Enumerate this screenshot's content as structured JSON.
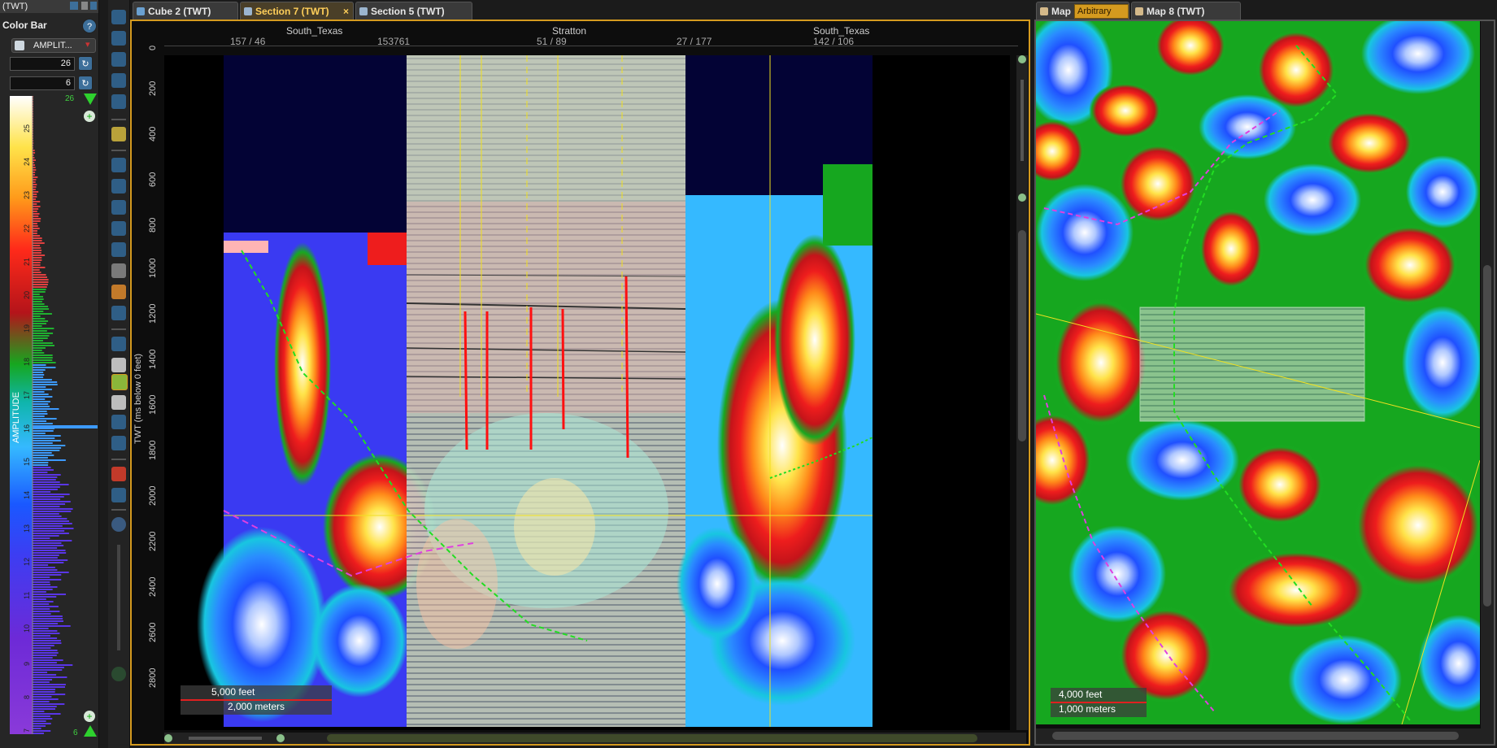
{
  "colorbar_panel": {
    "window_label": "(TWT)",
    "title": "Color Bar",
    "attribute_select": "AMPLIT...",
    "max_value": "26",
    "min_value": "6",
    "axis_label": "AMPLITUDE",
    "top_marker": "26",
    "bottom_marker": "6",
    "scale_ticks": [
      "25",
      "24",
      "23",
      "22",
      "21",
      "20",
      "19",
      "18",
      "17",
      "16",
      "15",
      "14",
      "13",
      "12",
      "11",
      "10",
      "9",
      "8",
      "7"
    ]
  },
  "tabs": {
    "left": [
      {
        "label": "Cube 2 (TWT)"
      },
      {
        "label": "Section 7 (TWT)",
        "close": "×"
      },
      {
        "label": "Section 5 (TWT)"
      }
    ],
    "right": [
      {
        "label": "Map"
      },
      {
        "label": "Arbitrary Line"
      },
      {
        "label": "Map 8 (TWT)"
      }
    ]
  },
  "section": {
    "top_labels": {
      "left_survey": "South_Texas",
      "mid_survey": "Stratton",
      "right_survey": "South_Texas",
      "trace1": "157 / 46",
      "trace2": "153761",
      "trace3": "51 / 89",
      "trace4": "27 / 177",
      "trace5": "142 / 106"
    },
    "y_axis_title": "TWT (ms below 0 feet)",
    "y_ticks": [
      "0",
      "200",
      "400",
      "600",
      "800",
      "1000",
      "1200",
      "1400",
      "1600",
      "1800",
      "2000",
      "2200",
      "2400",
      "2600",
      "2800"
    ],
    "scalebar": {
      "top": "5,000 feet",
      "bottom": "2,000 meters"
    }
  },
  "map": {
    "scalebar": {
      "top": "4,000 feet",
      "bottom": "1,000 meters"
    }
  },
  "colors": {
    "accent_active_tab": "#ffcf5a",
    "active_frame": "#d49a1f",
    "horizon_green": "#22dd22",
    "horizon_magenta": "#e040e0",
    "well_red": "#ff1010"
  }
}
